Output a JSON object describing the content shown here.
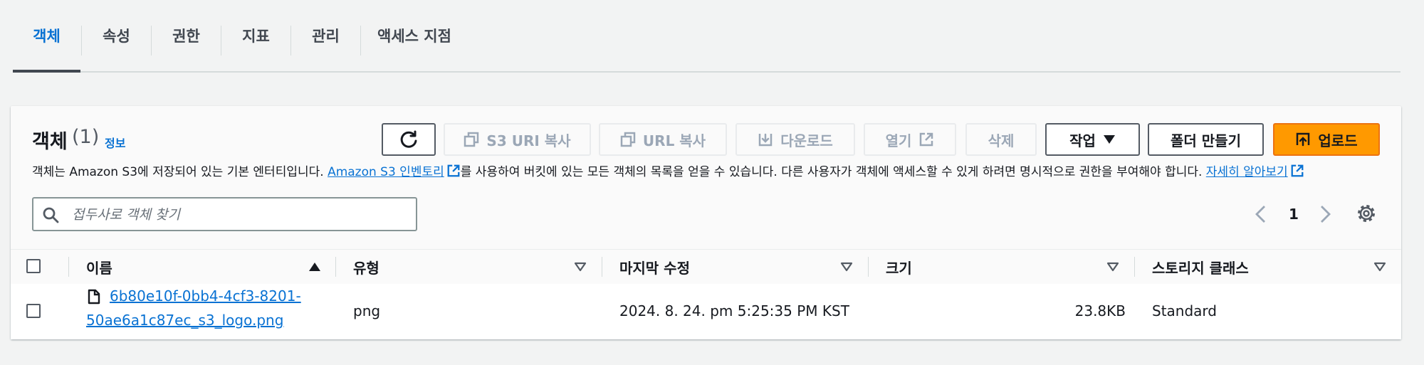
{
  "tabs": [
    "객체",
    "속성",
    "권한",
    "지표",
    "관리",
    "액세스 지점"
  ],
  "header": {
    "title": "객체",
    "count": "(1)",
    "info": "정보"
  },
  "buttons": {
    "copy_s3_uri": "S3 URI 복사",
    "copy_url": "URL 복사",
    "download": "다운로드",
    "open": "열기",
    "delete": "삭제",
    "actions": "작업",
    "create_folder": "폴더 만들기",
    "upload": "업로드"
  },
  "description": {
    "part1": "객체는 Amazon S3에 저장되어 있는 기본 엔터티입니다. ",
    "link1": "Amazon S3 인벤토리",
    "part2": "를 사용하여 버킷에 있는 모든 객체의 목록을 얻을 수 있습니다. 다른 사용자가 객체에 액세스할 수 있게 하려면 명시적으로 권한을 부여해야 합니다. ",
    "link2": "자세히 알아보기"
  },
  "search": {
    "placeholder": "접두사로 객체 찾기",
    "value": ""
  },
  "pagination": {
    "current_page": "1"
  },
  "table": {
    "columns": [
      "이름",
      "유형",
      "마지막 수정",
      "크기",
      "스토리지 클래스"
    ],
    "rows": [
      {
        "name_line1": "6b80e10f-0bb4-4cf3-8201-",
        "name_line2": "50ae6a1c87ec_s3_logo.png",
        "type": "png",
        "last_modified": "2024. 8. 24. pm 5:25:35 PM KST",
        "size": "23.8KB",
        "storage_class": "Standard"
      }
    ]
  },
  "colors": {
    "accent": "#0972d3",
    "primary_button": "#ff9900",
    "page_bg": "#f2f3f3"
  },
  "icons": [
    "refresh-icon",
    "copy-icon",
    "download-icon",
    "external-link-icon",
    "caret-down-icon",
    "upload-icon",
    "search-icon",
    "chevron-left-icon",
    "chevron-right-icon",
    "gear-icon",
    "sort-asc-icon",
    "sort-desc-icon",
    "file-icon"
  ]
}
